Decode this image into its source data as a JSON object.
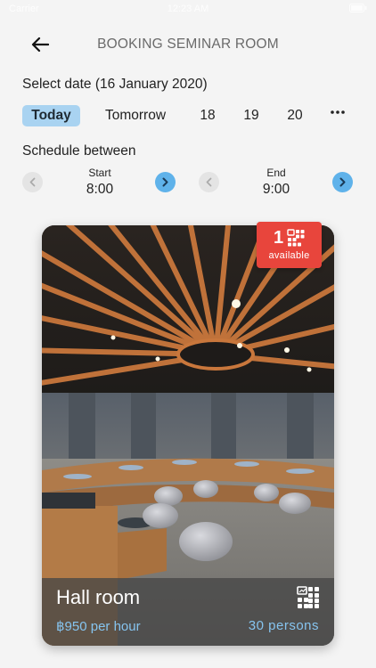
{
  "status_bar": {
    "carrier": "Carrier",
    "time": "12:23 AM"
  },
  "header": {
    "title": "BOOKING SEMINAR ROOM",
    "back_icon": "arrow-left-icon"
  },
  "date_section": {
    "label": "Select date (16 January 2020)",
    "options": [
      {
        "label": "Today",
        "selected": true
      },
      {
        "label": "Tomorrow",
        "selected": false
      },
      {
        "label": "18",
        "selected": false
      },
      {
        "label": "19",
        "selected": false
      },
      {
        "label": "20",
        "selected": false
      }
    ],
    "more_icon": "more-dots-icon"
  },
  "schedule": {
    "label": "Schedule between",
    "start": {
      "caption": "Start",
      "value": "8:00"
    },
    "end": {
      "caption": "End",
      "value": "9:00"
    }
  },
  "room": {
    "name": "Hall room",
    "price": "฿950 per hour",
    "capacity": "30 persons",
    "layout_icon": "seating-layout-icon",
    "available_count": "1",
    "available_label": "available"
  },
  "colors": {
    "accent": "#5fb2ea",
    "pill": "#a9d3f1",
    "badge": "#e8453c",
    "price": "#86c4ef"
  }
}
